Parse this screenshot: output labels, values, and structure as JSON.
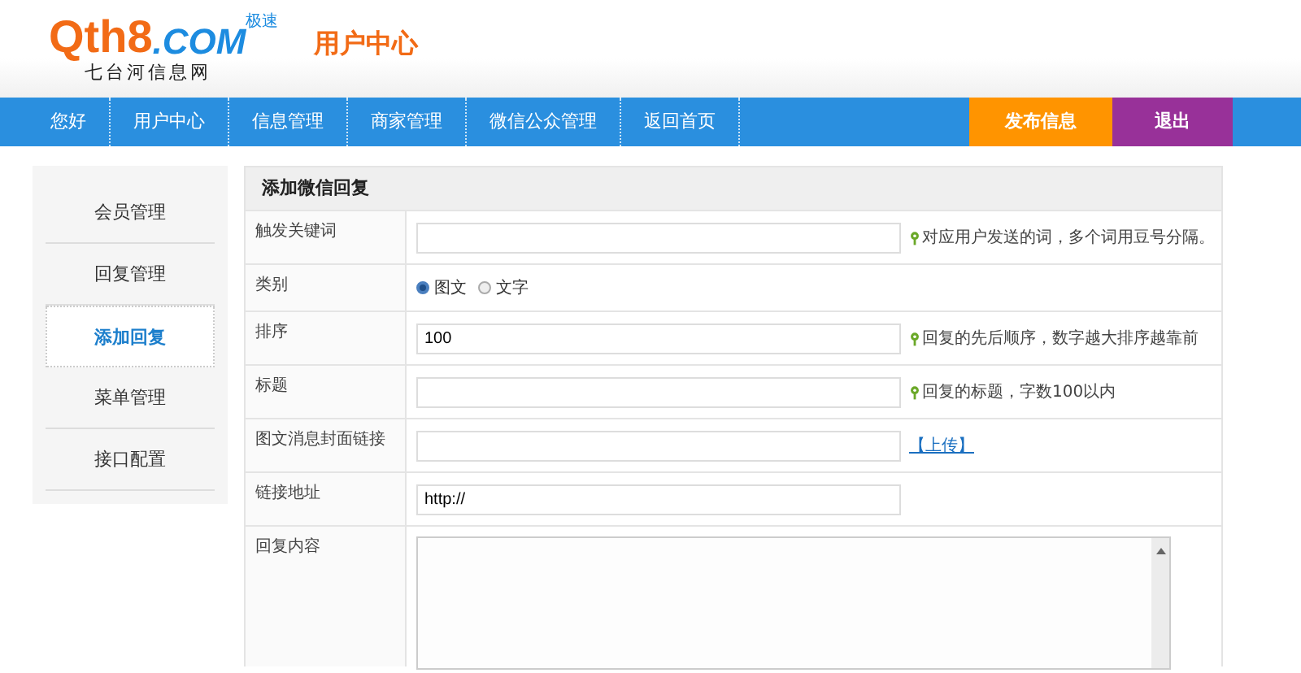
{
  "logo": {
    "brand": "Qth8",
    "domain": ".COM",
    "badge": "极速",
    "tagline": "七台河信息网"
  },
  "header_title": "用户中心",
  "nav": {
    "items": [
      {
        "label": "您好"
      },
      {
        "label": "用户中心"
      },
      {
        "label": "信息管理"
      },
      {
        "label": "商家管理"
      },
      {
        "label": "微信公众管理"
      },
      {
        "label": "返回首页"
      }
    ],
    "actions": [
      {
        "label": "发布信息",
        "kind": "publish"
      },
      {
        "label": "退出",
        "kind": "logout"
      }
    ]
  },
  "sidebar": {
    "items": [
      {
        "label": "会员管理",
        "selected": false
      },
      {
        "label": "回复管理",
        "selected": false
      },
      {
        "label": "添加回复",
        "selected": true
      },
      {
        "label": "菜单管理",
        "selected": false
      },
      {
        "label": "接口配置",
        "selected": false
      }
    ]
  },
  "form": {
    "title": "添加微信回复",
    "rows": [
      {
        "label": "触发关键词",
        "kind": "text",
        "value": "",
        "hint": "对应用户发送的词，多个词用豆号分隔。"
      },
      {
        "label": "类别",
        "kind": "radio",
        "options": [
          {
            "label": "图文",
            "selected": true
          },
          {
            "label": "文字",
            "selected": false
          }
        ]
      },
      {
        "label": "排序",
        "kind": "text",
        "value": "100",
        "hint": "回复的先后顺序，数字越大排序越靠前"
      },
      {
        "label": "标题",
        "kind": "text",
        "value": "",
        "hint": "回复的标题，字数100以内"
      },
      {
        "label": "图文消息封面链接",
        "kind": "upload",
        "value": "",
        "link": "【上传】"
      },
      {
        "label": "链接地址",
        "kind": "text",
        "value": "http://"
      },
      {
        "label": "回复内容",
        "kind": "textarea",
        "value": ""
      }
    ]
  }
}
